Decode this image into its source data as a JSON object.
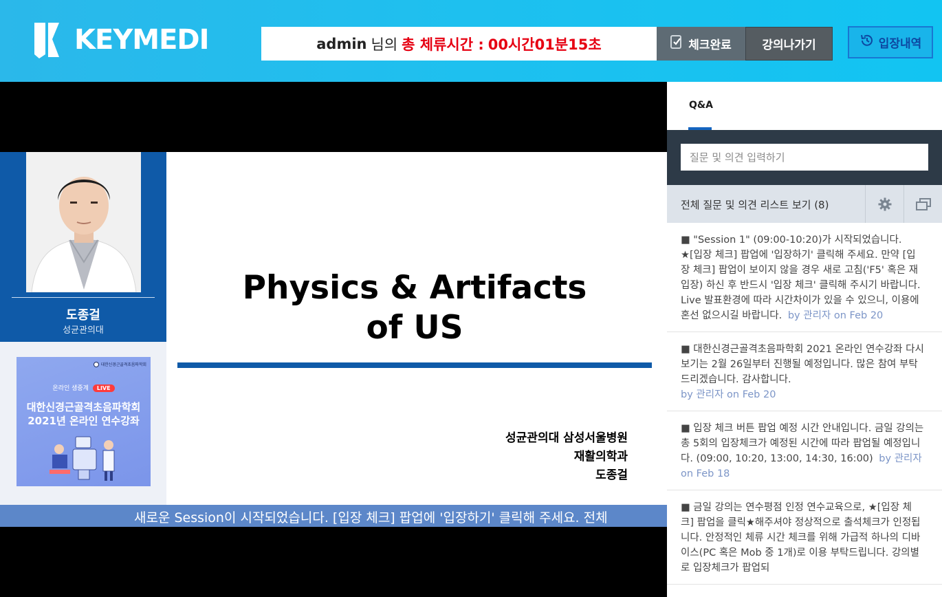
{
  "header": {
    "brand": "KEYMEDI",
    "timer": {
      "user": "admin",
      "user_suffix": "님의",
      "label": "총 체류시간 :",
      "value": "00시간01분15초"
    },
    "check_complete_label": "체크완료",
    "exit_label": "강의나가기",
    "history_label": "입장내역"
  },
  "slide": {
    "speaker_name": "도종걸",
    "speaker_affiliation": "성균관의대",
    "poster": {
      "org": "대한신경근골격초음파학회",
      "live_prefix": "온라인 생중계",
      "live_badge": "LIVE",
      "title_line1": "대한신경근골격초음파학회",
      "title_line2": "2021년 온라인 연수강좌"
    },
    "title_line1": "Physics & Artifacts",
    "title_line2": "of US",
    "affiliation_line1": "성균관의대 삼성서울병원",
    "affiliation_line2": "재활의학과",
    "affiliation_line3": "도종걸"
  },
  "ticker": "새로운 Session이 시작되었습니다.  [입장 체크] 팝업에 '입장하기' 클릭해 주세요. 전체",
  "qa": {
    "tab_label": "Q&A",
    "input_placeholder": "질문 및 의견 입력하기",
    "list_title": "전체 질문 및 의견 리스트 보기 (8)",
    "messages": [
      {
        "text": "■ \"Session 1\" (09:00-10:20)가 시작되었습니다. ★[입장 체크] 팝업에 '입장하기' 클릭해 주세요. 만약 [입장 체크] 팝업이 보이지 않을 경우 새로 고침('F5' 혹은 재입장) 하신 후 반드시 '입장 체크' 클릭해 주시기 바랍니다. Live 발표환경에 따라 시간차이가 있을 수 있으니, 이용에 혼선 없으시길 바랍니다.",
        "by": "by 관리자 on Feb 20"
      },
      {
        "text": "■ 대한신경근골격초음파학회 2021 온라인 연수강좌 다시보기는 2월 26일부터 진행될 예정입니다. 많은 참여 부탁드리겠습니다. 감사합니다.",
        "by": "by 관리자 on Feb 20"
      },
      {
        "text": "■ 입장 체크 버튼 팝업 예정 시간 안내입니다. 금일 강의는 총 5회의 입장체크가 예정된 시간에 따라 팝업될 예정입니다. (09:00, 10:20, 13:00, 14:30, 16:00)",
        "by": "by 관리자 on Feb 18"
      },
      {
        "text": "■ 금일 강의는 연수평점 인정 연수교육으로, ★[입장 체크] 팝업을 클릭★해주셔야 정상적으로 출석체크가 인정됩니다. 안정적인 체류 시간 체크를 위해 가급적 하나의 디바이스(PC 혹은 Mob 중 1개)로 이용 부탁드립니다. 강의별로 입장체크가 팝업되",
        "by": ""
      }
    ]
  },
  "colors": {
    "header_bg": "#1ec0ef",
    "timer_red": "#e60012",
    "slide_blue": "#0f5aa8",
    "ticker_bg": "#5c87c9",
    "input_bar_bg": "#2d3a47",
    "accent_blue": "#1565c0"
  },
  "icons": {
    "brand_logo": "keymedi-logo-icon",
    "check": "checklist-icon",
    "history": "clock-history-icon",
    "settings": "gear-icon",
    "popup": "popup-window-icon"
  }
}
